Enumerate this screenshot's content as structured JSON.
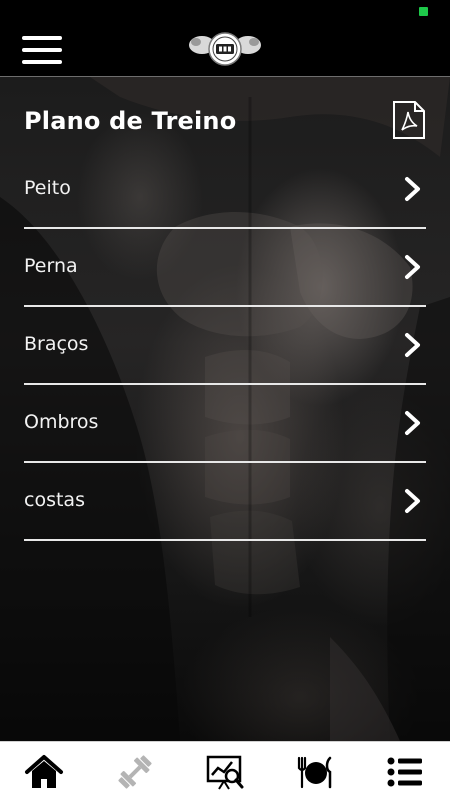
{
  "screen": {
    "title": "Plano de Treino"
  },
  "menu": {
    "items": [
      {
        "label": "Peito"
      },
      {
        "label": "Perna"
      },
      {
        "label": "Braços"
      },
      {
        "label": "Ombros"
      },
      {
        "label": "costas"
      }
    ]
  },
  "icons": {
    "header_menu": "hamburger-menu-icon",
    "logo": "gym-logo",
    "pdf": "pdf-file-icon",
    "item_arrow": "chevron-right-icon",
    "nav": [
      "home-icon",
      "dumbbell-icon",
      "assessment-chart-icon",
      "meal-plate-icon",
      "list-icon"
    ]
  },
  "colors": {
    "background": "#000000",
    "text": "#ffffff",
    "divider": "#e8e8e8",
    "nav_background": "#ffffff",
    "nav_active": "#000000",
    "nav_inactive": "#b4b4b4",
    "battery": "#1ec94a"
  }
}
